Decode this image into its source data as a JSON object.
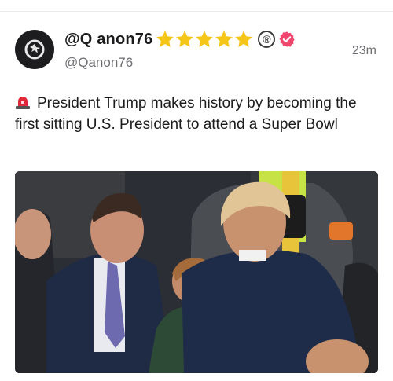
{
  "post": {
    "display_name": "@Q anon76",
    "handle": "@Qanon76",
    "timestamp": "23m",
    "badges": {
      "stars": 5,
      "star_icon": "star-icon",
      "registered_symbol": "®",
      "verified_icon": "verified-badge-icon"
    },
    "emoji_icon": "police-siren-icon",
    "text": "President Trump makes history by becoming the first sitting U.S. President to attend a Super Bowl",
    "media": {
      "type": "photo",
      "icon": "photo"
    }
  },
  "colors": {
    "star": "#f5c518",
    "verified": "#f0466e",
    "text": "#1c1c1e",
    "secondary": "#6e6e73"
  }
}
